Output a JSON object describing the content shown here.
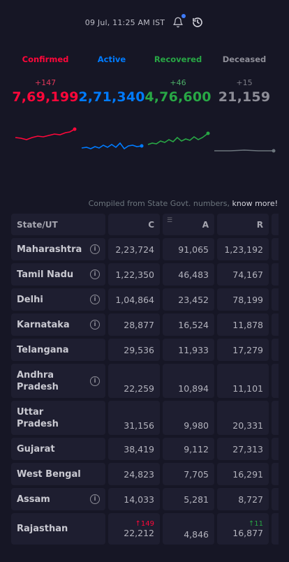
{
  "header": {
    "timestamp": "09 Jul, 11:25 AM IST"
  },
  "level": [
    {
      "key": "confirmed",
      "title": "Confirmed",
      "delta": "+147",
      "total": "7,69,199",
      "color": "#ff073a"
    },
    {
      "key": "active",
      "title": "Active",
      "delta": "",
      "total": "2,71,340",
      "color": "#007bff"
    },
    {
      "key": "recovered",
      "title": "Recovered",
      "delta": "+46",
      "total": "4,76,600",
      "color": "#28a745"
    },
    {
      "key": "deceased",
      "title": "Deceased",
      "delta": "+15",
      "total": "21,159",
      "color": "#6c757d"
    }
  ],
  "compiled": {
    "text": "Compiled from State Govt. numbers,",
    "link": "know more!"
  },
  "table": {
    "headers": {
      "state": "State/UT",
      "c": "C",
      "a": "A",
      "r": "R"
    },
    "rows": [
      {
        "state": "Maharashtra",
        "info": true,
        "c": "2,23,724",
        "a": "91,065",
        "r": "1,23,192"
      },
      {
        "state": "Tamil Nadu",
        "info": true,
        "c": "1,22,350",
        "a": "46,483",
        "r": "74,167"
      },
      {
        "state": "Delhi",
        "info": true,
        "c": "1,04,864",
        "a": "23,452",
        "r": "78,199"
      },
      {
        "state": "Karnataka",
        "info": true,
        "c": "28,877",
        "a": "16,524",
        "r": "11,878"
      },
      {
        "state": "Telangana",
        "info": false,
        "c": "29,536",
        "a": "11,933",
        "r": "17,279"
      },
      {
        "state": "Andhra Pradesh",
        "info": true,
        "c": "22,259",
        "a": "10,894",
        "r": "11,101"
      },
      {
        "state": "Uttar Pradesh",
        "info": false,
        "c": "31,156",
        "a": "9,980",
        "r": "20,331"
      },
      {
        "state": "Gujarat",
        "info": false,
        "c": "38,419",
        "a": "9,112",
        "r": "27,313"
      },
      {
        "state": "West Bengal",
        "info": false,
        "c": "24,823",
        "a": "7,705",
        "r": "16,291"
      },
      {
        "state": "Assam",
        "info": true,
        "c": "14,033",
        "a": "5,281",
        "r": "8,727"
      },
      {
        "state": "Rajasthan",
        "info": false,
        "c": "22,212",
        "c_delta": "↑149",
        "a": "4,846",
        "r": "16,877",
        "r_delta": "↑11"
      }
    ]
  }
}
